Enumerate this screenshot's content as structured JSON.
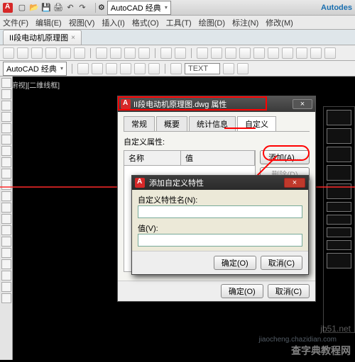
{
  "app": {
    "product_label": "Autodes",
    "workspace_label": "AutoCAD 经典"
  },
  "menu": {
    "file": "文件(F)",
    "edit": "编辑(E)",
    "view": "视图(V)",
    "insert": "插入(I)",
    "format": "格式(O)",
    "tools": "工具(T)",
    "draw": "绘图(D)",
    "dimension": "标注(N)",
    "modify": "修改(M)"
  },
  "doc_tab": {
    "name": "II段电动机原理图",
    "close": "×"
  },
  "toolbar2": {
    "workspace": "AutoCAD 经典",
    "text_sample": "TEXT"
  },
  "viewport": {
    "label": "[-][俯视][二维线框]"
  },
  "props_dialog": {
    "title": "II段电动机原理图.dwg 属性",
    "close": "×",
    "tabs": {
      "general": "常规",
      "summary": "概要",
      "stats": "统计信息",
      "custom": "自定义"
    },
    "section_label": "自定义属性:",
    "col_name": "名称",
    "col_value": "值",
    "btn_add": "添加(A)...",
    "btn_delete": "删除(D)",
    "btn_ok": "确定(O)",
    "btn_cancel": "取消(C)"
  },
  "add_dialog": {
    "title": "添加自定义特性",
    "close": "×",
    "name_label": "自定义特性名(N):",
    "name_value": "",
    "value_label": "值(V):",
    "value_value": "",
    "btn_ok": "确定(O)",
    "btn_cancel": "取消(C)"
  },
  "watermark": {
    "site": "jb51.net",
    "brand": "查字典教程网",
    "url": "jiaocheng.chazidian.com"
  }
}
